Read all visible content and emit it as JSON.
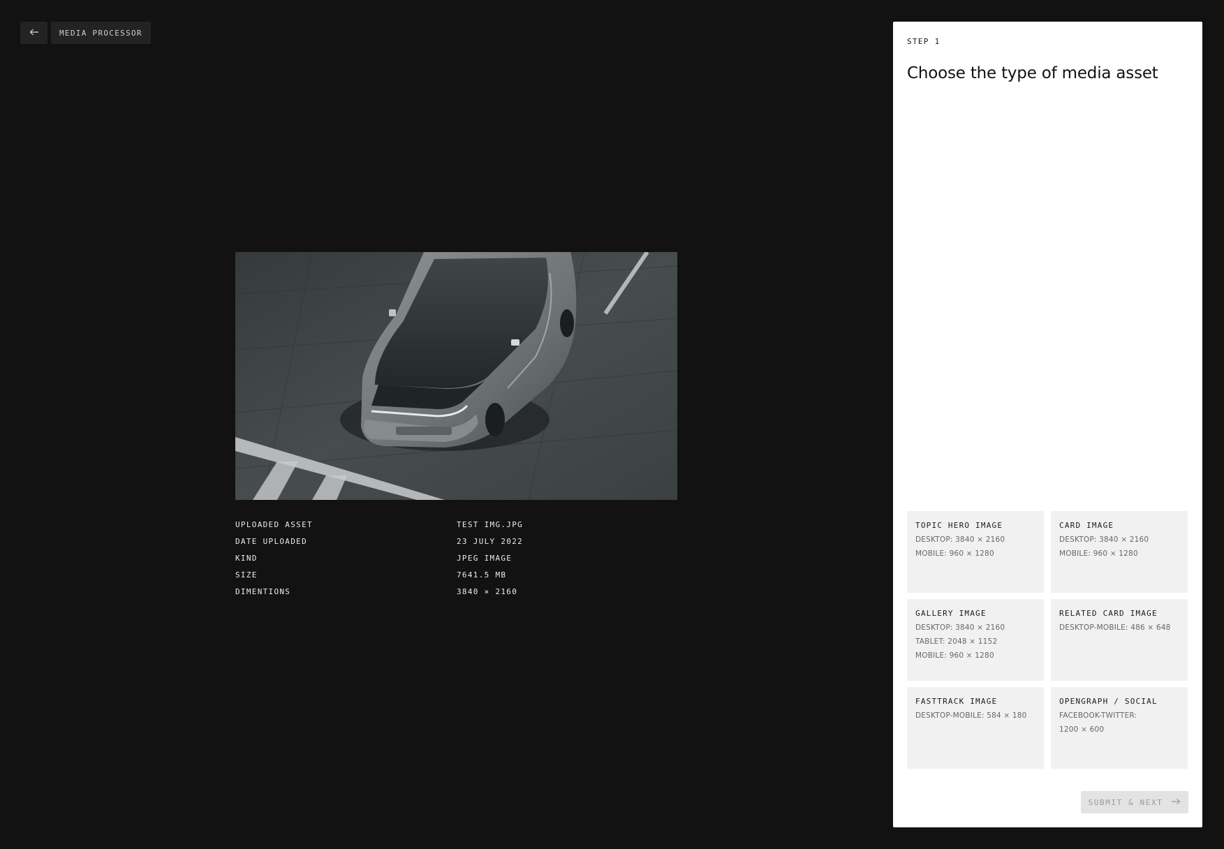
{
  "header": {
    "app_label": "MEDIA PROCESSOR"
  },
  "preview": {
    "icon": "car-photo"
  },
  "meta": {
    "rows": [
      {
        "label": "UPLOADED ASSET",
        "value": "TEST IMG.JPG"
      },
      {
        "label": "DATE UPLOADED",
        "value": "23 JULY 2022"
      },
      {
        "label": "KIND",
        "value": "JPEG IMAGE"
      },
      {
        "label": "SIZE",
        "value": "7641.5 MB"
      },
      {
        "label": "DIMENTIONS",
        "value": "3840 × 2160"
      }
    ]
  },
  "panel": {
    "step": "STEP 1",
    "title": "Choose the type of media asset",
    "cards": [
      {
        "title": "TOPIC HERO IMAGE",
        "specs": [
          "DESKTOP: 3840 × 2160",
          "MOBILE: 960 × 1280"
        ]
      },
      {
        "title": "CARD IMAGE",
        "specs": [
          "DESKTOP: 3840 × 2160",
          "MOBILE: 960 × 1280"
        ]
      },
      {
        "title": "GALLERY IMAGE",
        "specs": [
          "DESKTOP: 3840 × 2160",
          "TABLET: 2048 × 1152",
          "MOBILE: 960 × 1280"
        ]
      },
      {
        "title": "RELATED CARD IMAGE",
        "specs": [
          "DESKTOP-MOBILE: 486 × 648"
        ]
      },
      {
        "title": "FASTTRACK IMAGE",
        "specs": [
          "DESKTOP-MOBILE: 584 × 180"
        ]
      },
      {
        "title": "OPENGRAPH / SOCIAL",
        "specs": [
          "FACEBOOK-TWITTER:",
          "1200 × 600"
        ]
      }
    ],
    "submit_label": "SUBMIT & NEXT"
  },
  "colors": {
    "background": "#121212",
    "panel": "#ffffff",
    "card": "#f1f1f1",
    "button_disabled": "#e3e3e3"
  }
}
